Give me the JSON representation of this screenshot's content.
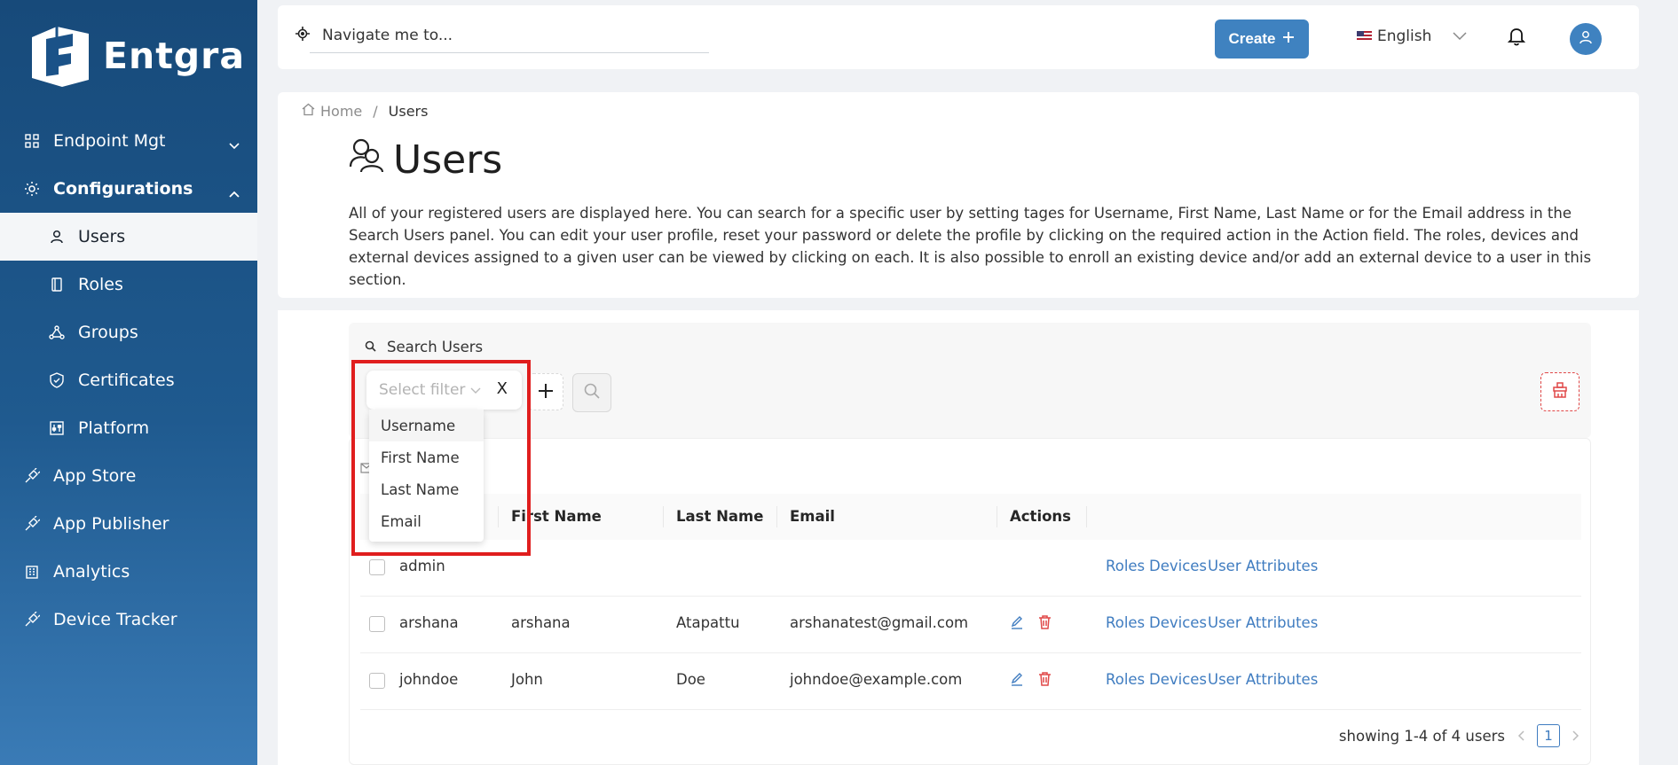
{
  "brand": {
    "name": "Entgra"
  },
  "sidebar": {
    "items": [
      {
        "label": "Endpoint Mgt",
        "icon": "grid-icon",
        "expandable": true,
        "expanded": false
      },
      {
        "label": "Configurations",
        "icon": "gear-icon",
        "expandable": true,
        "expanded": true
      },
      {
        "label": "Users",
        "icon": "user-icon",
        "sub": true,
        "active": true
      },
      {
        "label": "Roles",
        "icon": "book-icon",
        "sub": true
      },
      {
        "label": "Groups",
        "icon": "network-icon",
        "sub": true
      },
      {
        "label": "Certificates",
        "icon": "shield-check-icon",
        "sub": true
      },
      {
        "label": "Platform",
        "icon": "sliders-icon",
        "sub": true
      },
      {
        "label": "App Store",
        "icon": "plug-icon"
      },
      {
        "label": "App Publisher",
        "icon": "plug-icon"
      },
      {
        "label": "Analytics",
        "icon": "building-icon"
      },
      {
        "label": "Device Tracker",
        "icon": "plug-icon"
      }
    ]
  },
  "header": {
    "search_placeholder": "Navigate me to...",
    "create_label": "Create",
    "language": "English"
  },
  "breadcrumb": {
    "home": "Home",
    "current": "Users"
  },
  "page": {
    "title": "Users",
    "description": "All of your registered users are displayed here. You can search for a specific user by setting tages for Username, First Name, Last Name or for the Email address in the Search Users panel. You can edit your user profile, reset your password or delete the profile by clicking on the required action in the Action field. The roles, devices and external devices assigned to a given user can be viewed by clicking on each. It is also possible to enroll an existing device and/or add an external device to a user in this section."
  },
  "search_panel": {
    "title": "Search Users",
    "filter_placeholder": "Select filter",
    "filter_clear": "X",
    "filter_options": [
      "Username",
      "First Name",
      "Last Name",
      "Email"
    ]
  },
  "table": {
    "columns": [
      "First Name",
      "Last Name",
      "Email",
      "Actions"
    ],
    "rows": [
      {
        "username": "admin",
        "first_name": "",
        "last_name": "",
        "email": "",
        "editable": false
      },
      {
        "username": "arshana",
        "first_name": "arshana",
        "last_name": "Atapattu",
        "email": "arshanatest@gmail.com",
        "editable": true
      },
      {
        "username": "johndoe",
        "first_name": "John",
        "last_name": "Doe",
        "email": "johndoe@example.com",
        "editable": true
      }
    ],
    "row_links": [
      "Roles",
      "Devices",
      "User Attributes"
    ],
    "pagination_text": "showing 1-4 of 4 users",
    "current_page": "1"
  },
  "colors": {
    "sidebar": "#1f5a8f",
    "accent": "#3f82c0",
    "danger": "#e01e1e",
    "link": "#3f7cc0"
  }
}
